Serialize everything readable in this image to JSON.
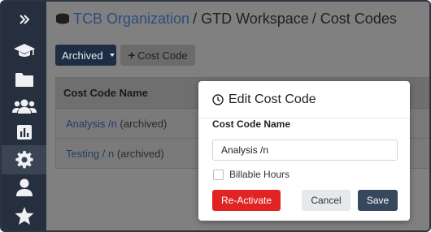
{
  "sidebar": {
    "items": [
      {
        "icon": "chevrons-right-icon"
      },
      {
        "icon": "graduation-cap-icon"
      },
      {
        "icon": "folder-icon"
      },
      {
        "icon": "users-icon"
      },
      {
        "icon": "bar-chart-icon"
      },
      {
        "icon": "gear-icon",
        "active": true
      },
      {
        "icon": "user-icon"
      },
      {
        "icon": "star-icon"
      }
    ]
  },
  "breadcrumb": {
    "org": "TCB Organization",
    "sep": "/",
    "workspace": "GTD Workspace",
    "page": "Cost Codes"
  },
  "toolbar": {
    "archived_label": "Archived",
    "add_label": "Cost Code"
  },
  "table": {
    "header": "Cost Code Name",
    "rows": [
      {
        "name": "Analysis /n",
        "tag": "(archived)"
      },
      {
        "name": "Testing / n",
        "tag": "(archived)"
      }
    ]
  },
  "modal": {
    "title": "Edit Cost Code",
    "field_label": "Cost Code Name",
    "field_value": "Analysis /n",
    "checkbox_label": "Billable Hours",
    "reactivate_label": "Re-Activate",
    "cancel_label": "Cancel",
    "save_label": "Save"
  },
  "colors": {
    "sidebar_bg": "#262f3d",
    "link": "#2c4d7c",
    "danger": "#e02424",
    "primary": "#37475d"
  }
}
